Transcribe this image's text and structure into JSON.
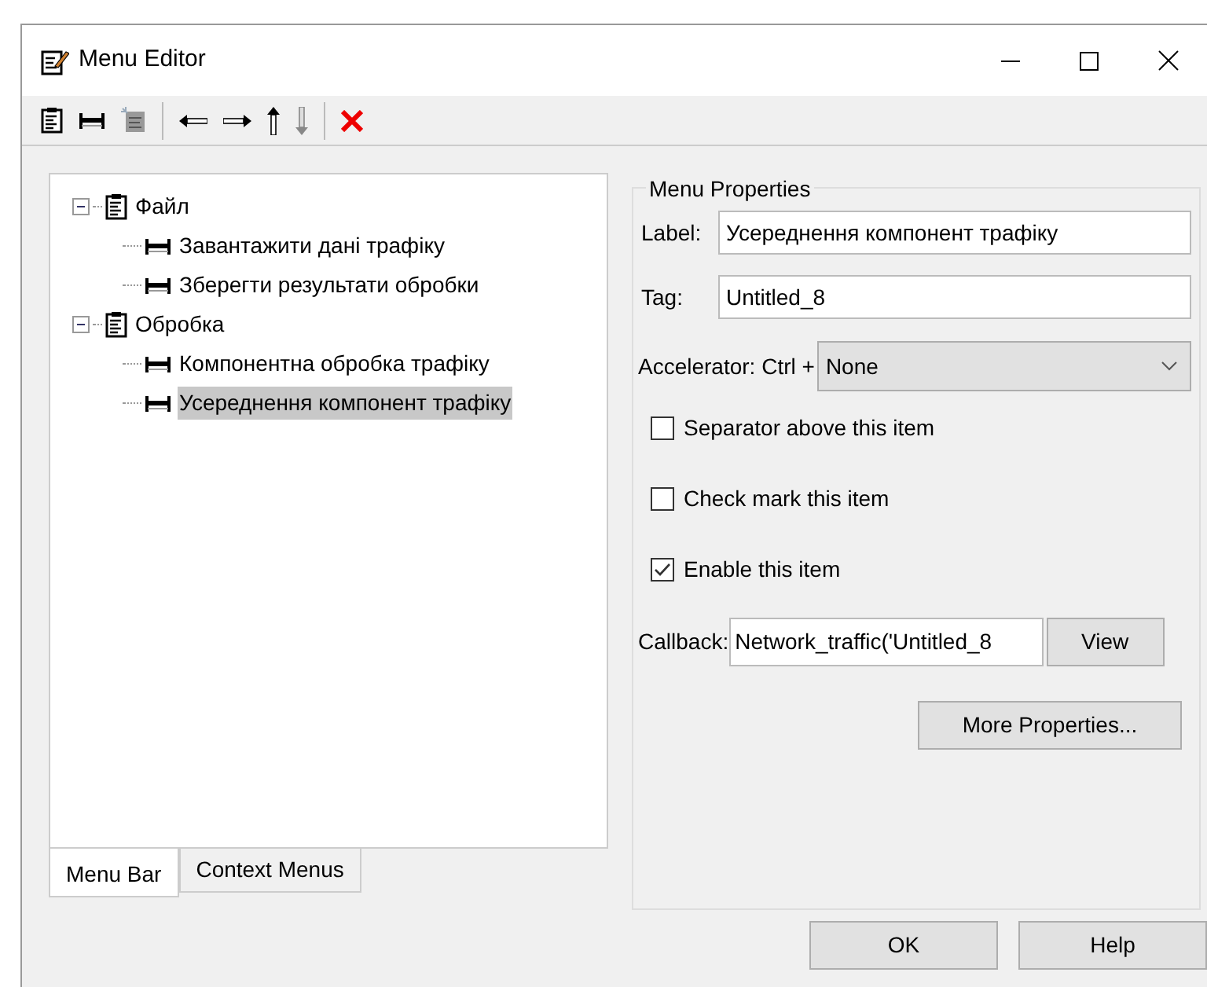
{
  "window": {
    "title": "Menu Editor"
  },
  "tree": [
    {
      "label": "Файл",
      "kind": "menu",
      "expanded": true,
      "selected": false,
      "children": [
        {
          "label": "Завантажити дані трафіку",
          "kind": "item",
          "selected": false
        },
        {
          "label": "Зберегти результати обробки",
          "kind": "item",
          "selected": false
        }
      ]
    },
    {
      "label": "Обробка",
      "kind": "menu",
      "expanded": true,
      "selected": false,
      "children": [
        {
          "label": "Компонентна обробка трафіку",
          "kind": "item",
          "selected": false
        },
        {
          "label": "Усереднення компонент трафіку",
          "kind": "item",
          "selected": true
        }
      ]
    }
  ],
  "tabs": [
    {
      "label": "Menu Bar",
      "selected": true
    },
    {
      "label": "Context Menus",
      "selected": false
    }
  ],
  "properties": {
    "title": "Menu Properties",
    "label": {
      "caption": "Label:",
      "value": "Усереднення компонент трафіку"
    },
    "tag": {
      "caption": "Tag:",
      "value": "Untitled_8"
    },
    "accelerator": {
      "caption": "Accelerator: Ctrl +",
      "value": "None"
    },
    "checkboxes": [
      {
        "label": "Separator above this item",
        "checked": false
      },
      {
        "label": "Check mark this item",
        "checked": false
      },
      {
        "label": "Enable this item",
        "checked": true
      }
    ],
    "callback": {
      "caption": "Callback:",
      "value": "Network_traffic('Untitled_8",
      "button": "View"
    },
    "more": "More Properties..."
  },
  "buttons": [
    "OK",
    "Help"
  ]
}
